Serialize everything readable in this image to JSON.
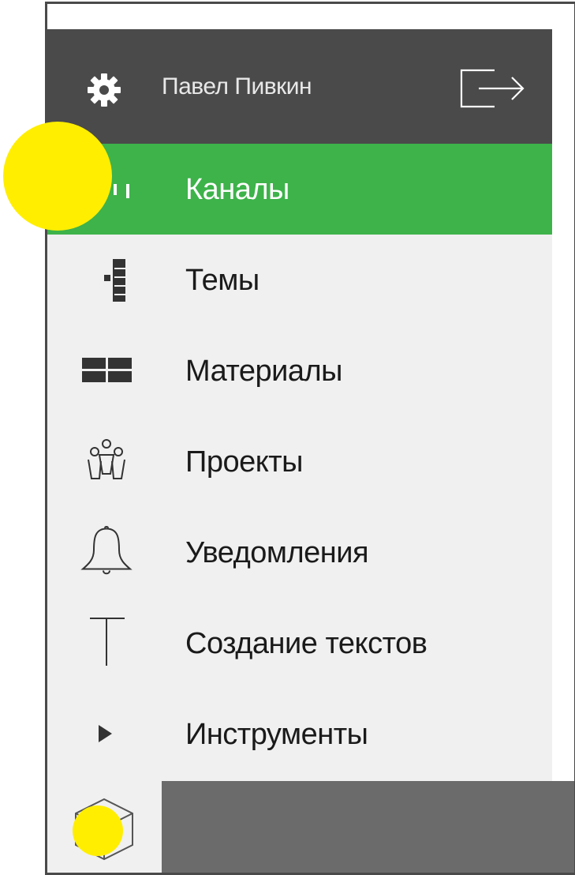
{
  "header": {
    "user_name": "Павел Пивкин",
    "icons": {
      "settings": "gear-icon",
      "logout": "logout-icon"
    }
  },
  "menu": {
    "items": [
      {
        "label": "Каналы",
        "icon": "channels-icon",
        "active": true
      },
      {
        "label": "Темы",
        "icon": "topics-icon",
        "active": false
      },
      {
        "label": "Материалы",
        "icon": "materials-icon",
        "active": false
      },
      {
        "label": "Проекты",
        "icon": "projects-icon",
        "active": false
      },
      {
        "label": "Уведомления",
        "icon": "bell-icon",
        "active": false
      },
      {
        "label": "Создание текстов",
        "icon": "text-icon",
        "active": false
      },
      {
        "label": "Инструменты",
        "icon": "play-icon",
        "active": false
      }
    ]
  },
  "footer": {
    "icon": "cube-icon"
  },
  "colors": {
    "header_bg": "#4a4a4a",
    "active_bg": "#3db34a",
    "menu_bg": "#f0f0f0",
    "footer_bg": "#6b6b6b",
    "highlight": "#ffee00"
  }
}
